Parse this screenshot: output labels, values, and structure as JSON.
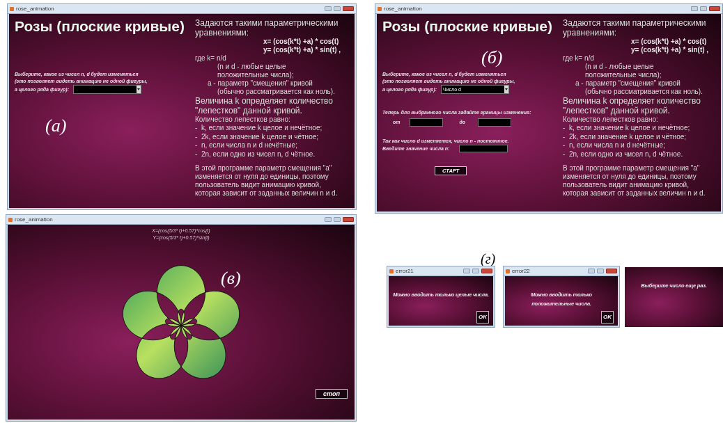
{
  "windows": [
    {
      "kind": "setup",
      "figure_label": "(а)",
      "title": "rose_animation",
      "heading": "Розы (плоские кривые)",
      "choose_prompt": [
        "Выберите, какое из чисел n, d будет  изменяться",
        "(это позволяет  видеть  анимацию не одной фигуры,",
        "а целого ряда фигур):"
      ],
      "info": [
        {
          "kind": "heading",
          "text": "Задаются такими параметрическими"
        },
        {
          "kind": "heading",
          "text": "уравнениями:"
        },
        {
          "kind": "formula",
          "text": "x= (cos(k*t) +a) * cos(t)"
        },
        {
          "kind": "formula",
          "text": "y= (cos(k*t) +a) * sin(t) ,"
        },
        {
          "kind": "plain",
          "text": "где k= n/d"
        },
        {
          "kind": "indent2",
          "text": "(n и d - любые целые"
        },
        {
          "kind": "indent2",
          "text": "положительные числа);"
        },
        {
          "kind": "indent1",
          "text": "a - параметр \"смещения\" кривой"
        },
        {
          "kind": "indent2",
          "text": "(обычно рассматривается как ноль)."
        },
        {
          "kind": "heading",
          "text": "Величина k определяет количество"
        },
        {
          "kind": "heading",
          "text": "\"лепестков\" данной кривой."
        },
        {
          "kind": "plain",
          "text": "Количество лепестков равно:"
        },
        {
          "kind": "item",
          "text": "-  k, если значение k целое и нечётное;"
        },
        {
          "kind": "item",
          "text": "-  2k, если значение k целое и чётное;"
        },
        {
          "kind": "item",
          "text": "-  n, если числа n и d нечётные;"
        },
        {
          "kind": "item",
          "text": "-  2n, если одно из чисел n, d чётное."
        },
        {
          "kind": "note",
          "text": "В этой программе параметр смещения \"a\""
        },
        {
          "kind": "note",
          "text": "изменяется от нуля до единицы, поэтому"
        },
        {
          "kind": "note",
          "text": "пользователь видит анимацию кривой,"
        },
        {
          "kind": "note",
          "text": "которая зависит от заданных величин n и d."
        }
      ]
    },
    {
      "kind": "setup",
      "figure_label": "(б)",
      "title": "rose_animation",
      "heading": "Розы (плоские кривые)",
      "choose_prompt": [
        "Выберите, какое из чисел n, d будет  изменяться",
        "(это позволяет  видеть  анимацию не одной фигуры,",
        "а целого ряда фигур):"
      ],
      "dropdown": {
        "value": "Число d"
      },
      "range_prompt": "Теперь для выбранного числа задайте границы изменения:",
      "range_from_label": "от",
      "range_to_label": "до",
      "constant_prompt": [
        "Так как число d изменяется, число n - постоянное.",
        "Введите значение числа n:"
      ],
      "start_button": "СТАРТ",
      "info": [
        {
          "kind": "heading",
          "text": "Задаются такими параметрическими"
        },
        {
          "kind": "heading",
          "text": "уравнениями:"
        },
        {
          "kind": "formula",
          "text": "x= (cos(k*t) +a) * cos(t)"
        },
        {
          "kind": "formula",
          "text": "y= (cos(k*t) +a) * sin(t) ,"
        },
        {
          "kind": "plain",
          "text": "где k= n/d"
        },
        {
          "kind": "indent2",
          "text": "(n и d - любые целые"
        },
        {
          "kind": "indent2",
          "text": "положительные числа);"
        },
        {
          "kind": "indent1",
          "text": "a - параметр \"смещения\" кривой"
        },
        {
          "kind": "indent2",
          "text": "(обычно рассматривается как ноль)."
        },
        {
          "kind": "heading",
          "text": "Величина k определяет количество"
        },
        {
          "kind": "heading",
          "text": "\"лепестков\" данной кривой."
        },
        {
          "kind": "plain",
          "text": "Количество лепестков равно:"
        },
        {
          "kind": "item",
          "text": "-  k, если значение k целое и нечётное;"
        },
        {
          "kind": "item",
          "text": "-  2k, если значение k целое и чётное;"
        },
        {
          "kind": "item",
          "text": "-  n, если числа n и d нечётные;"
        },
        {
          "kind": "item",
          "text": "-  2n, если одно из чисел n, d чётное."
        },
        {
          "kind": "note",
          "text": "В этой программе параметр смещения \"a\""
        },
        {
          "kind": "note",
          "text": "изменяется от нуля до единицы, поэтому"
        },
        {
          "kind": "note",
          "text": "пользователь видит анимацию кривой,"
        },
        {
          "kind": "note",
          "text": "которая зависит от заданных величин n и d."
        }
      ]
    },
    {
      "kind": "animation",
      "figure_label": "(в)",
      "title": "rose_animation",
      "formula_lines": [
        "X=(cos(5/3* t)+0.57)*cos(t)",
        "Y=(cos(5/3* t)+0.57)*sin(t)"
      ],
      "stop_button": "стоп"
    }
  ],
  "error_group_label": "(г)",
  "dialogs": [
    {
      "kind": "window",
      "title": "error21",
      "message": [
        "Можно вводить только целые числа."
      ],
      "button": "OK"
    },
    {
      "kind": "window",
      "title": "error22",
      "message": [
        "Можно вводить только",
        "положительные числа."
      ],
      "button": "OK"
    },
    {
      "kind": "frameless",
      "message": [
        "Выберите число еще раз."
      ]
    }
  ]
}
